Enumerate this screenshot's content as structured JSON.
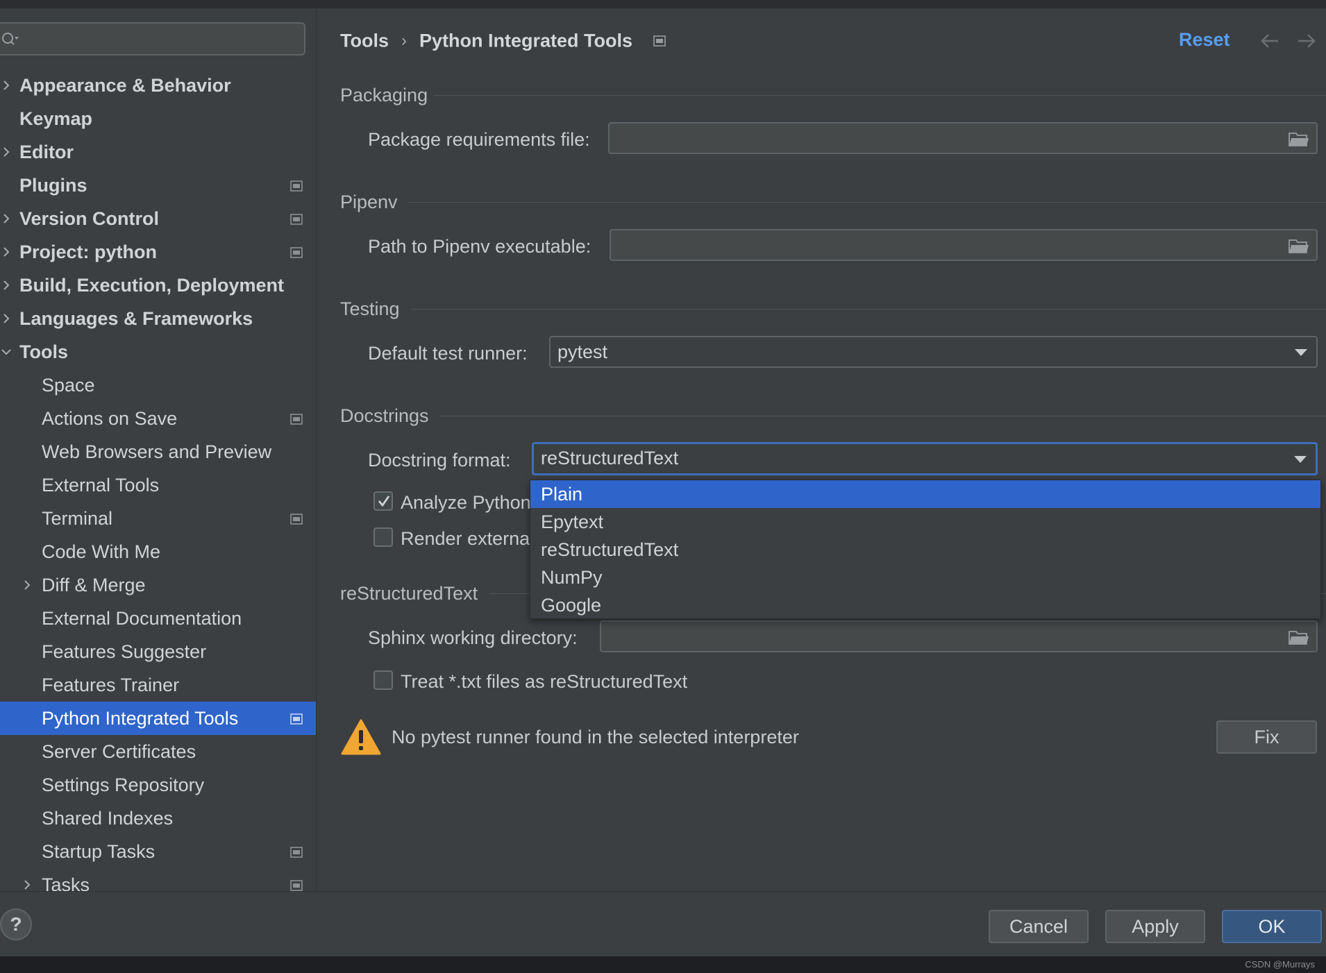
{
  "search": {
    "placeholder": ""
  },
  "sidebar": {
    "items": [
      {
        "label": "Appearance & Behavior",
        "level": 0,
        "expandable": true,
        "expanded": false,
        "bold": true,
        "project_icon": false,
        "selected": false
      },
      {
        "label": "Keymap",
        "level": 0,
        "expandable": false,
        "expanded": false,
        "bold": true,
        "project_icon": false,
        "selected": false
      },
      {
        "label": "Editor",
        "level": 0,
        "expandable": true,
        "expanded": false,
        "bold": true,
        "project_icon": false,
        "selected": false
      },
      {
        "label": "Plugins",
        "level": 0,
        "expandable": false,
        "expanded": false,
        "bold": true,
        "project_icon": true,
        "selected": false
      },
      {
        "label": "Version Control",
        "level": 0,
        "expandable": true,
        "expanded": false,
        "bold": true,
        "project_icon": true,
        "selected": false
      },
      {
        "label": "Project: python",
        "level": 0,
        "expandable": true,
        "expanded": false,
        "bold": true,
        "project_icon": true,
        "selected": false
      },
      {
        "label": "Build, Execution, Deployment",
        "level": 0,
        "expandable": true,
        "expanded": false,
        "bold": true,
        "project_icon": false,
        "selected": false
      },
      {
        "label": "Languages & Frameworks",
        "level": 0,
        "expandable": true,
        "expanded": false,
        "bold": true,
        "project_icon": false,
        "selected": false
      },
      {
        "label": "Tools",
        "level": 0,
        "expandable": true,
        "expanded": true,
        "bold": true,
        "project_icon": false,
        "selected": false
      },
      {
        "label": "Space",
        "level": 1,
        "expandable": false,
        "expanded": false,
        "bold": false,
        "project_icon": false,
        "selected": false
      },
      {
        "label": "Actions on Save",
        "level": 1,
        "expandable": false,
        "expanded": false,
        "bold": false,
        "project_icon": true,
        "selected": false
      },
      {
        "label": "Web Browsers and Preview",
        "level": 1,
        "expandable": false,
        "expanded": false,
        "bold": false,
        "project_icon": false,
        "selected": false
      },
      {
        "label": "External Tools",
        "level": 1,
        "expandable": false,
        "expanded": false,
        "bold": false,
        "project_icon": false,
        "selected": false
      },
      {
        "label": "Terminal",
        "level": 1,
        "expandable": false,
        "expanded": false,
        "bold": false,
        "project_icon": true,
        "selected": false
      },
      {
        "label": "Code With Me",
        "level": 1,
        "expandable": false,
        "expanded": false,
        "bold": false,
        "project_icon": false,
        "selected": false
      },
      {
        "label": "Diff & Merge",
        "level": 1,
        "expandable": true,
        "expanded": false,
        "bold": false,
        "project_icon": false,
        "selected": false
      },
      {
        "label": "External Documentation",
        "level": 1,
        "expandable": false,
        "expanded": false,
        "bold": false,
        "project_icon": false,
        "selected": false
      },
      {
        "label": "Features Suggester",
        "level": 1,
        "expandable": false,
        "expanded": false,
        "bold": false,
        "project_icon": false,
        "selected": false
      },
      {
        "label": "Features Trainer",
        "level": 1,
        "expandable": false,
        "expanded": false,
        "bold": false,
        "project_icon": false,
        "selected": false
      },
      {
        "label": "Python Integrated Tools",
        "level": 1,
        "expandable": false,
        "expanded": false,
        "bold": false,
        "project_icon": true,
        "selected": true
      },
      {
        "label": "Server Certificates",
        "level": 1,
        "expandable": false,
        "expanded": false,
        "bold": false,
        "project_icon": false,
        "selected": false
      },
      {
        "label": "Settings Repository",
        "level": 1,
        "expandable": false,
        "expanded": false,
        "bold": false,
        "project_icon": false,
        "selected": false
      },
      {
        "label": "Shared Indexes",
        "level": 1,
        "expandable": false,
        "expanded": false,
        "bold": false,
        "project_icon": false,
        "selected": false
      },
      {
        "label": "Startup Tasks",
        "level": 1,
        "expandable": false,
        "expanded": false,
        "bold": false,
        "project_icon": true,
        "selected": false
      },
      {
        "label": "Tasks",
        "level": 1,
        "expandable": true,
        "expanded": false,
        "bold": false,
        "project_icon": true,
        "selected": false
      }
    ]
  },
  "header": {
    "breadcrumb_parent": "Tools",
    "breadcrumb_current": "Python Integrated Tools",
    "reset_label": "Reset",
    "back_icon": "arrow-left-icon",
    "forward_icon": "arrow-right-icon"
  },
  "packaging": {
    "title": "Packaging",
    "requirements_label": "Package requirements file:",
    "requirements_value": ""
  },
  "pipenv": {
    "title": "Pipenv",
    "path_label": "Path to Pipenv executable:",
    "path_value": ""
  },
  "testing": {
    "title": "Testing",
    "runner_label": "Default test runner:",
    "runner_value": "pytest"
  },
  "docstrings": {
    "title": "Docstrings",
    "format_label": "Docstring format:",
    "format_value": "reStructuredText",
    "analyze_label": "Analyze Python",
    "analyze_checked": true,
    "render_label": "Render externa",
    "render_checked": false,
    "options": [
      "Plain",
      "Epytext",
      "reStructuredText",
      "NumPy",
      "Google"
    ],
    "highlighted_option": "Plain"
  },
  "rst": {
    "title": "reStructuredText",
    "sphinx_label": "Sphinx working directory:",
    "sphinx_value": "",
    "treat_txt_label": "Treat *.txt files as reStructuredText",
    "treat_txt_checked": false
  },
  "warning": {
    "text": "No pytest runner found in the selected interpreter",
    "fix_label": "Fix"
  },
  "footer": {
    "help_label": "?",
    "cancel_label": "Cancel",
    "apply_label": "Apply",
    "ok_label": "OK"
  },
  "watermark": "CSDN @Murrays",
  "colors": {
    "background": "#3c3f41",
    "selection": "#2f65ca",
    "link": "#589df6",
    "primary_button": "#365880",
    "warning": "#f0a732"
  }
}
